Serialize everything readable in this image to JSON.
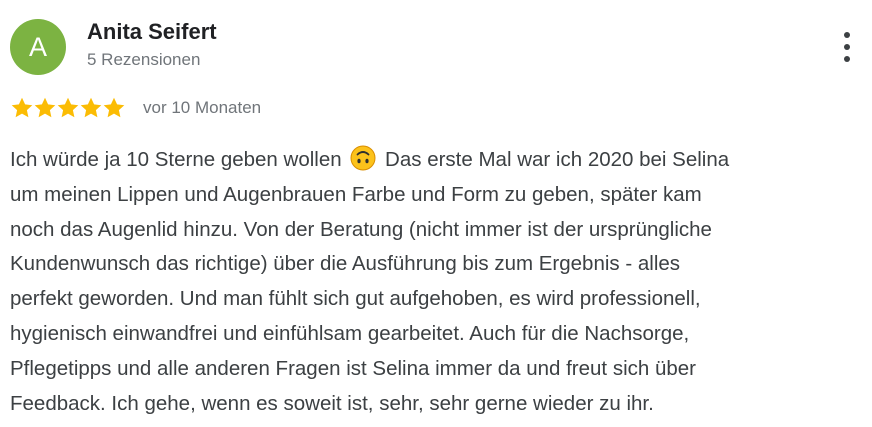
{
  "review": {
    "author": {
      "initial": "A",
      "name": "Anita Seifert",
      "reviews_count": "5 Rezensionen",
      "avatar_color": "#7cb342"
    },
    "rating": {
      "stars": 5,
      "max_stars": 5,
      "star_color": "#fbbc04"
    },
    "time_ago": "vor 10 Monaten",
    "more_icon": "more-vert-icon",
    "text_lines": [
      {
        "before": "Ich würde ja 10 Sterne geben wollen",
        "emoji": "upside-down-face-emoji",
        "after": "Das erste Mal war ich 2020 bei Selina"
      },
      {
        "text": "um meinen Lippen und Augenbrauen Farbe und Form zu geben, später kam"
      },
      {
        "text": "noch das Augenlid hinzu. Von der Beratung (nicht immer ist der ursprüngliche"
      },
      {
        "text": "Kundenwunsch das richtige) über die Ausführung bis zum Ergebnis - alles"
      },
      {
        "text": "perfekt geworden. Und man fühlt sich gut aufgehoben, es wird professionell,"
      },
      {
        "text": "hygienisch einwandfrei und einfühlsam gearbeitet. Auch für die Nachsorge,"
      },
      {
        "text": "Pflegetipps und alle anderen Fragen ist Selina immer da und freut sich über"
      },
      {
        "text": "Feedback. Ich gehe, wenn es soweit ist, sehr, sehr gerne wieder zu ihr."
      }
    ]
  }
}
